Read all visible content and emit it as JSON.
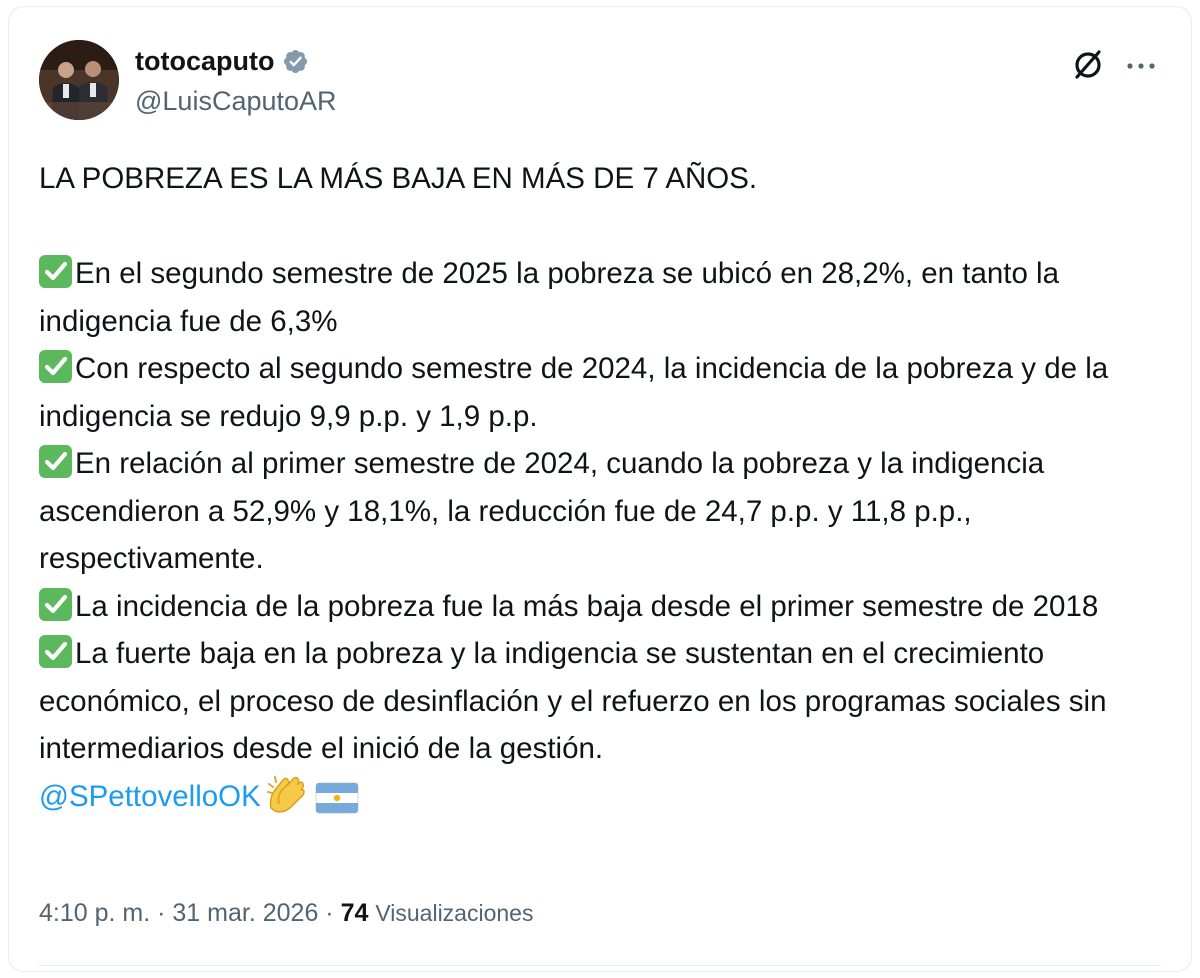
{
  "author": {
    "display_name": "totocaputo",
    "handle": "@LuisCaputoAR",
    "verified": true
  },
  "tweet": {
    "headline": "LA POBREZA ES LA MÁS BAJA EN MÁS DE 7 AÑOS.",
    "bullets": [
      "En el segundo semestre de 2025 la pobreza se ubicó en 28,2%, en tanto la indigencia fue de 6,3%",
      "Con respecto al segundo semestre de 2024, la incidencia de la pobreza y de la indigencia se redujo 9,9 p.p. y 1,9 p.p.",
      "En relación al primer semestre de 2024, cuando la pobreza y la indigencia ascendieron a 52,9% y 18,1%, la reducción fue de 24,7 p.p. y 11,8 p.p., respectivamente.",
      "La incidencia de la pobreza fue la más baja desde el primer semestre de 2018",
      "La fuerte baja en la pobreza y la indigencia se sustentan en el crecimiento económico, el proceso de desinflación y el refuerzo en los programas sociales sin intermediarios desde el inició de la gestión."
    ],
    "mention": "@SPettovelloOK",
    "emojis": [
      "clapping-hands-emoji",
      "argentina-flag-emoji"
    ]
  },
  "meta": {
    "time": "4:10 p. m.",
    "separator": "·",
    "date": "31 mar. 2026",
    "views_count": "74",
    "views_label": "Visualizaciones"
  },
  "icons": {
    "verified": "verified-badge-icon",
    "grok": "grok-icon",
    "more": "more-options-icon"
  },
  "colors": {
    "text": "#0f1419",
    "secondary": "#536471",
    "link": "#1d9bf0",
    "check": "#5cb85c",
    "border": "#e6ecf0"
  }
}
